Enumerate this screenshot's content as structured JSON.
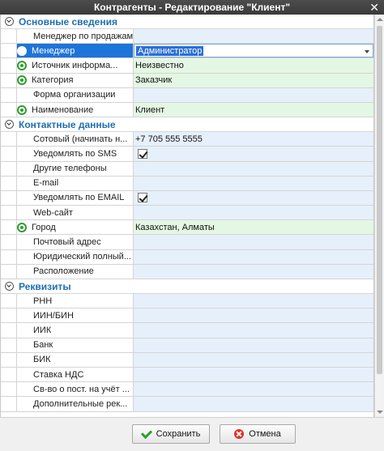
{
  "window": {
    "title": "Контрагенты - Редактирование \"Клиент\"",
    "close_glyph": "✕"
  },
  "sections": [
    {
      "title": "Основные сведения",
      "rows": [
        {
          "label": "Менеджер по продажам",
          "value": "",
          "required": false
        },
        {
          "label": "Менеджер",
          "value": "Администратор",
          "required": true,
          "selected": true,
          "combo": true
        },
        {
          "label": "Источник информа...",
          "value": "Неизвестно",
          "required": true
        },
        {
          "label": "Категория",
          "value": "Заказчик",
          "required": true
        },
        {
          "label": "Форма организации",
          "value": "",
          "required": false
        },
        {
          "label": "Наименование",
          "value": "Клиент",
          "required": true
        }
      ]
    },
    {
      "title": "Контактные данные",
      "rows": [
        {
          "label": "Сотовый (начинать н...",
          "value": "+7 705 555 5555",
          "required": false
        },
        {
          "label": "Уведомлять по SMS",
          "value": "",
          "checkbox": true,
          "checked": true
        },
        {
          "label": "Другие телефоны",
          "value": "",
          "required": false
        },
        {
          "label": "E-mail",
          "value": "",
          "required": false
        },
        {
          "label": "Уведомлять по EMAIL",
          "value": "",
          "checkbox": true,
          "checked": true
        },
        {
          "label": "Web-сайт",
          "value": "",
          "required": false
        },
        {
          "label": "Город",
          "value": "Казахстан, Алматы",
          "required": true
        },
        {
          "label": "Почтовый адрес",
          "value": "",
          "required": false
        },
        {
          "label": "Юридический полный...",
          "value": "",
          "required": false
        },
        {
          "label": "Расположение",
          "value": "",
          "required": false
        }
      ]
    },
    {
      "title": "Реквизиты",
      "rows": [
        {
          "label": "РНН",
          "value": ""
        },
        {
          "label": "ИИН/БИН",
          "value": ""
        },
        {
          "label": "ИИК",
          "value": ""
        },
        {
          "label": "Банк",
          "value": ""
        },
        {
          "label": "БИК",
          "value": ""
        },
        {
          "label": "Ставка НДС",
          "value": ""
        },
        {
          "label": "Св-во о пост. на учёт ...",
          "value": ""
        },
        {
          "label": "Дополнительные рек...",
          "value": ""
        }
      ]
    }
  ],
  "footer": {
    "save_label": "Сохранить",
    "cancel_label": "Отмена"
  }
}
